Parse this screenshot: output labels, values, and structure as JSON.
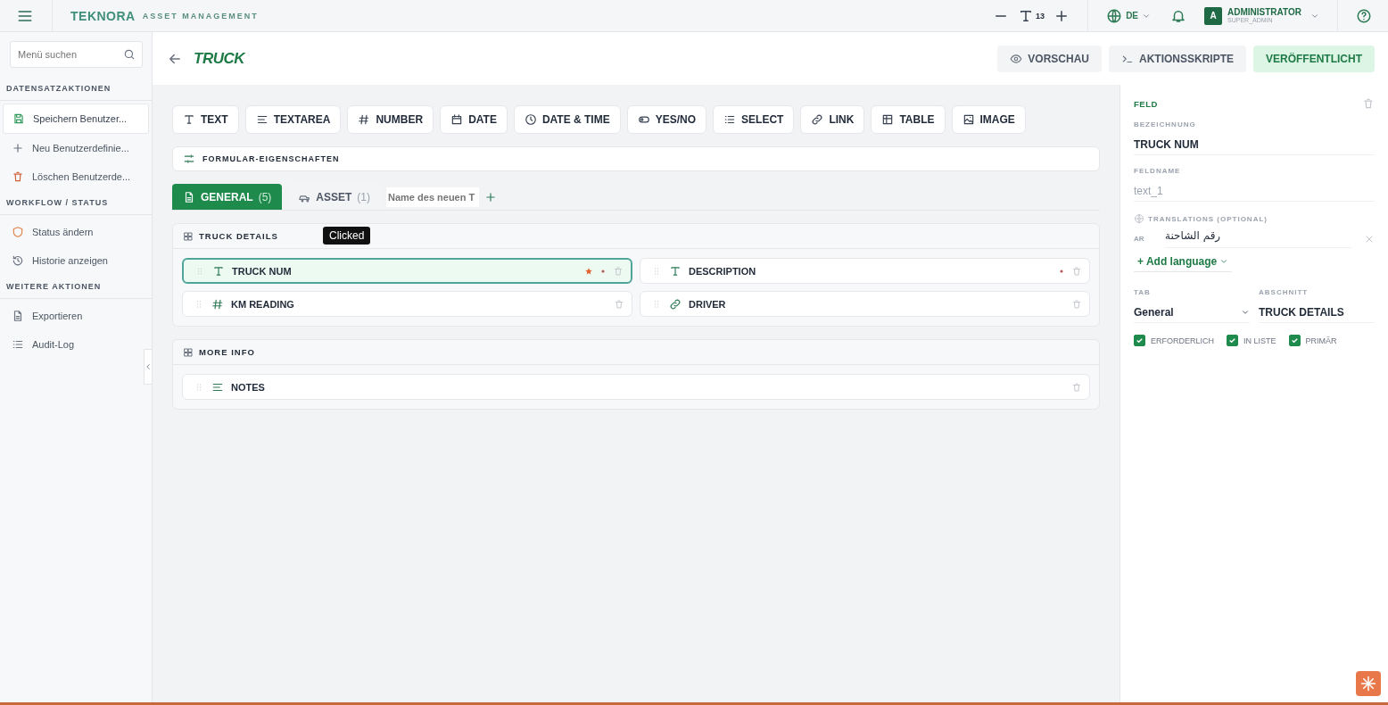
{
  "topbar": {
    "brand": "TEKNORA",
    "product": "ASSET MANAGEMENT",
    "font_size": "13",
    "language": "DE",
    "user": {
      "initial": "A",
      "name": "ADMINISTRATOR",
      "role": "SUPER_ADMIN"
    }
  },
  "sidebar": {
    "search": {
      "placeholder": "Menü suchen"
    },
    "groups": [
      {
        "title": "DATENSATZAKTIONEN",
        "items": [
          {
            "label": "Speichern Benutzer...",
            "kind": "save",
            "selected": true
          },
          {
            "label": "Neu Benutzerdefinie...",
            "kind": "plus",
            "selected": false
          },
          {
            "label": "Löschen Benutzerde...",
            "kind": "trash",
            "selected": false
          }
        ]
      },
      {
        "title": "WORKFLOW / STATUS",
        "items": [
          {
            "label": "Status ändern",
            "kind": "shield",
            "selected": false
          },
          {
            "label": "Historie anzeigen",
            "kind": "history",
            "selected": false
          }
        ]
      },
      {
        "title": "WEITERE AKTIONEN",
        "items": [
          {
            "label": "Exportieren",
            "kind": "file",
            "selected": false
          },
          {
            "label": "Audit-Log",
            "kind": "list",
            "selected": false
          }
        ]
      }
    ]
  },
  "header": {
    "title": "TRUCK",
    "buttons": [
      {
        "label": "VORSCHAU",
        "kind": "eye"
      },
      {
        "label": "AKTIONSSKRIPTE",
        "kind": "terminal"
      },
      {
        "label": "VERÖFFENTLICHT",
        "kind": "status"
      }
    ]
  },
  "palette": [
    {
      "label": "TEXT",
      "kind": "text"
    },
    {
      "label": "TEXTAREA",
      "kind": "textarea"
    },
    {
      "label": "NUMBER",
      "kind": "number"
    },
    {
      "label": "DATE",
      "kind": "date"
    },
    {
      "label": "DATE & TIME",
      "kind": "datetime"
    },
    {
      "label": "YES/NO",
      "kind": "toggle"
    },
    {
      "label": "SELECT",
      "kind": "select"
    },
    {
      "label": "LINK",
      "kind": "link"
    },
    {
      "label": "TABLE",
      "kind": "table"
    },
    {
      "label": "IMAGE",
      "kind": "image"
    }
  ],
  "form_properties": "FORMULAR-EIGENSCHAFTEN",
  "tabs": [
    {
      "label": "GENERAL",
      "count": "(5)",
      "kind": "file",
      "selected": true
    },
    {
      "label": "ASSET",
      "count": "(1)",
      "kind": "car",
      "selected": false
    }
  ],
  "new_tab": {
    "placeholder": "Name des neuen T"
  },
  "sections": [
    {
      "title": "TRUCK DETAILS",
      "kind": "grid",
      "fields": [
        {
          "label": "TRUCK NUM",
          "kind": "text",
          "selected": true,
          "starred": true,
          "marked": true
        },
        {
          "label": "DESCRIPTION",
          "kind": "text",
          "selected": false,
          "starred": false,
          "marked": true
        },
        {
          "label": "KM READING",
          "kind": "number",
          "selected": false,
          "starred": false,
          "marked": false
        },
        {
          "label": "DRIVER",
          "kind": "link",
          "selected": false,
          "starred": false,
          "marked": false
        }
      ]
    },
    {
      "title": "MORE INFO",
      "kind": "list",
      "fields": [
        {
          "label": "NOTES",
          "kind": "textarea",
          "selected": false,
          "starred": false,
          "marked": false
        }
      ]
    }
  ],
  "tooltip": "Clicked",
  "inspector": {
    "title": "FELD",
    "label_caption": "BEZEICHNUNG",
    "label_value": "TRUCK NUM",
    "name_caption": "FELDNAME",
    "name_value": "text_1",
    "translations_caption": "TRANSLATIONS (OPTIONAL)",
    "translations": [
      {
        "lang": "AR",
        "value": "رقم الشاحنة"
      }
    ],
    "add_language": "+ Add language",
    "tab_caption": "TAB",
    "tab_value": "General",
    "section_caption": "ABSCHNITT",
    "section_value": "TRUCK DETAILS",
    "checks": [
      {
        "label": "ERFORDERLICH",
        "checked": true
      },
      {
        "label": "IN LISTE",
        "checked": true
      },
      {
        "label": "PRIMÄR",
        "checked": true
      }
    ]
  }
}
